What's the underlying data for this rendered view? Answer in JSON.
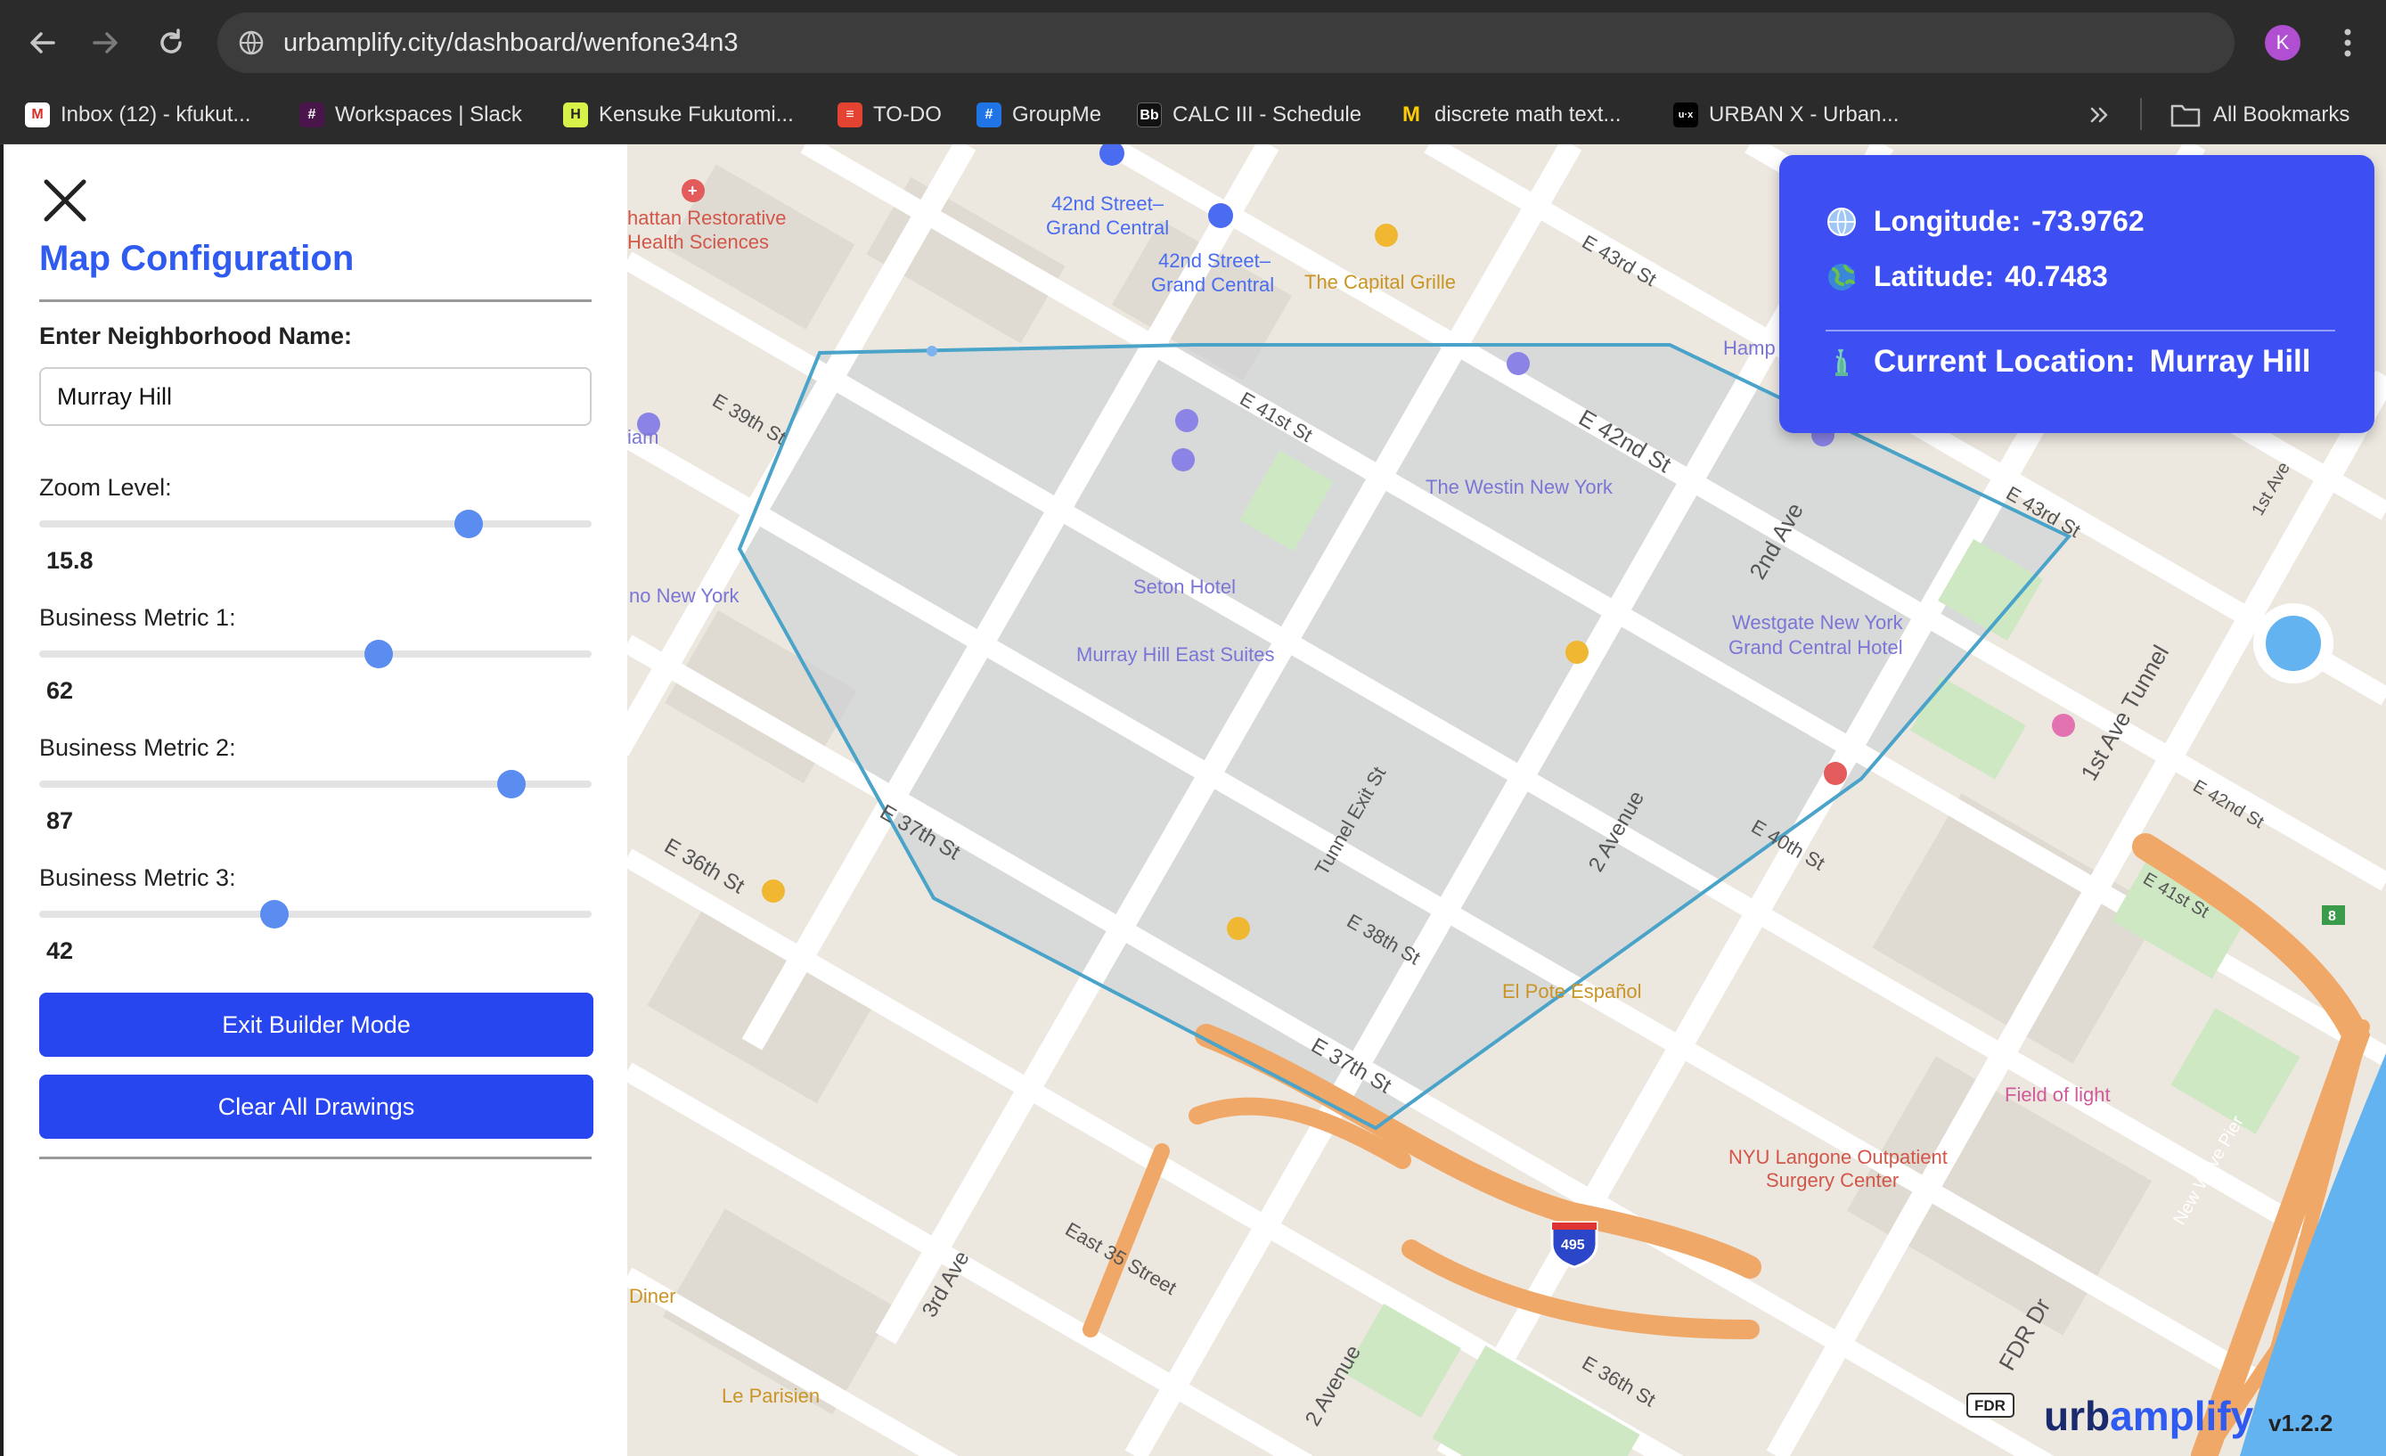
{
  "browser": {
    "url": "urbamplify.city/dashboard/wenfone34n3",
    "profile_initial": "K",
    "bookmarks": [
      {
        "label": "Inbox (12) - kfukut...",
        "icon": "gmail-icon"
      },
      {
        "label": "Workspaces | Slack",
        "icon": "slack-icon"
      },
      {
        "label": "Kensuke Fukutomi...",
        "icon": "site-icon"
      },
      {
        "label": "TO-DO",
        "icon": "todoist-icon"
      },
      {
        "label": "GroupMe",
        "icon": "groupme-icon"
      },
      {
        "label": "CALC III - Schedule",
        "icon": "blackboard-icon"
      },
      {
        "label": "discrete math text...",
        "icon": "umich-icon"
      },
      {
        "label": "URBAN X - Urban...",
        "icon": "urbanx-icon"
      }
    ],
    "all_bookmarks_label": "All Bookmarks"
  },
  "sidebar": {
    "title": "Map Configuration",
    "neighborhood_label": "Enter Neighborhood Name:",
    "neighborhood_value": "Murray Hill",
    "zoom_label": "Zoom Level:",
    "zoom_value": "15.8",
    "zoom_fraction": 0.78,
    "metric1_label": "Business Metric 1:",
    "metric1_value": "62",
    "metric2_label": "Business Metric 2:",
    "metric2_value": "87",
    "metric3_label": "Business Metric 3:",
    "metric3_value": "42",
    "exit_button": "Exit Builder Mode",
    "clear_button": "Clear All Drawings"
  },
  "info_card": {
    "longitude_label": "Longitude:",
    "longitude_value": "-73.9762",
    "latitude_label": "Latitude:",
    "latitude_value": "40.7483",
    "location_label": "Current Location:",
    "location_value": "Murray Hill"
  },
  "map": {
    "labels": {
      "restorative": "hattan Restorative",
      "health_sciences": "Health Sciences",
      "grand_central_1a": "42nd Street–",
      "grand_central_1b": "Grand Central",
      "grand_central_2a": "42nd Street–",
      "grand_central_2b": "Grand Central",
      "capital_grille": "The Capital Grille",
      "e43_top": "E 43rd St",
      "hamp": "Hamp",
      "e39": "E 39th St",
      "iam": "iam",
      "e41": "E 41st St",
      "e42": "E 42nd St",
      "westin": "The Westin New York",
      "second_ave": "2nd Ave",
      "e43_right": "E 43rd St",
      "first_ave": "1st Ave",
      "seton": "Seton Hotel",
      "no_new_york": "no New York",
      "murray_suites": "Murray Hill East Suites",
      "westgate_1": "Westgate New York",
      "westgate_2": "Grand Central Hotel",
      "tunnel": "1st Ave Tunnel",
      "e37_left": "E 37th St",
      "tunnel_exit": "Tunnel Exit St",
      "two_avenue_mid": "2 Avenue",
      "e40": "E 40th St",
      "e42_right": "E 42nd St",
      "e41_right": "E 41st St",
      "e36_left": "E 36th St",
      "e38": "E 38th St",
      "el_pote": "El Pote Español",
      "e37_mid": "E 37th St",
      "field_of_light": "Field of light",
      "nyu_1": "NYU Langone Outpatient",
      "nyu_2": "Surgery Center",
      "new_wave": "New Wave Pier",
      "third_ave": "3rd Ave",
      "east35": "East 35 Street",
      "diner": "Diner",
      "le_parisien": "Le Parisien",
      "two_avenue_bottom": "2 Avenue",
      "e36_bottom": "E 36th St",
      "fdr_dr": "FDR Dr",
      "fdr_shield": "FDR",
      "i495": "495",
      "route8": "8"
    }
  },
  "brand": {
    "name_part1": "urb",
    "name_part2": "amplify",
    "version": "v1.2.2"
  },
  "colors": {
    "accent": "#2f5bf0",
    "button": "#2846f0",
    "info_card": "#3d4ef3",
    "polygon_stroke": "#4aa3c9",
    "water": "#62b3f0",
    "highway": "#f0a868"
  }
}
